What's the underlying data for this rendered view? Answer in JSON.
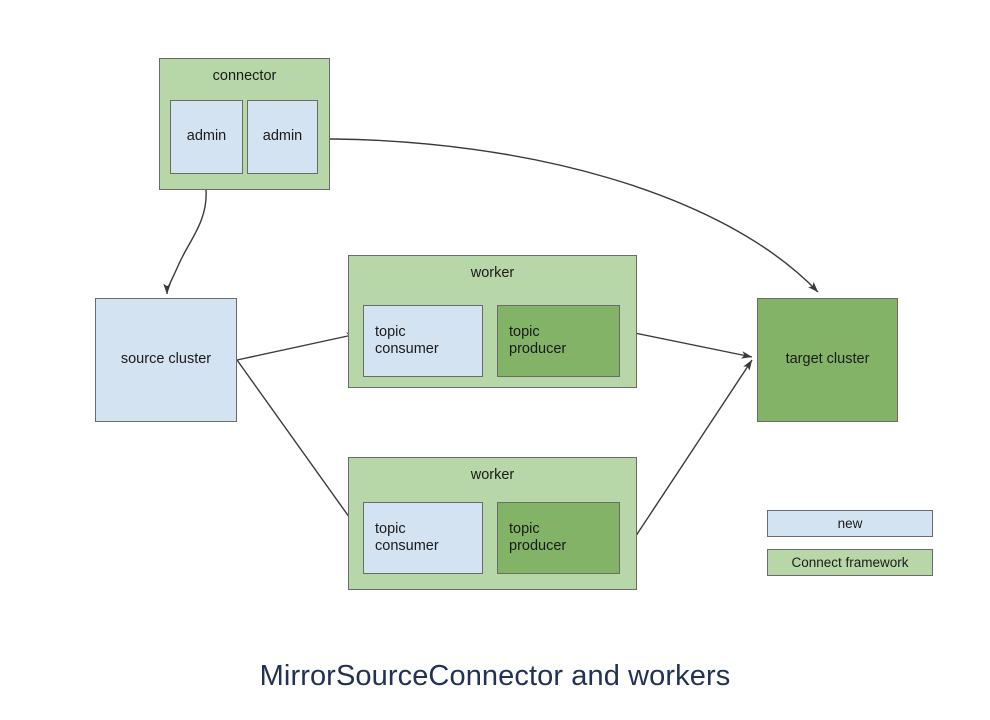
{
  "title": "MirrorSourceConnector and workers",
  "colors": {
    "new": "#d4e3f2",
    "connect_framework": "#b7d7a8",
    "connect_framework_dark": "#82b366",
    "border": "#6b6b6b",
    "edge": "#3a3a3a",
    "title_text": "#233154",
    "node_text": "#1a1a1a",
    "background": "#ffffff"
  },
  "nodes": {
    "connector": {
      "label": "connector",
      "fill": "connect_framework",
      "children": [
        {
          "label": "admin",
          "fill": "new"
        },
        {
          "label": "admin",
          "fill": "new"
        }
      ]
    },
    "source_cluster": {
      "label": "source cluster",
      "fill": "new"
    },
    "target_cluster": {
      "label": "target cluster",
      "fill": "connect_framework_dark"
    },
    "worker_1": {
      "label": "worker",
      "fill": "connect_framework",
      "consumer": {
        "line1": "topic",
        "line2": "consumer",
        "fill": "new"
      },
      "producer": {
        "line1": "topic",
        "line2": "producer",
        "fill": "connect_framework_dark"
      }
    },
    "worker_2": {
      "label": "worker",
      "fill": "connect_framework",
      "consumer": {
        "line1": "topic",
        "line2": "consumer",
        "fill": "new"
      },
      "producer": {
        "line1": "topic",
        "line2": "producer",
        "fill": "connect_framework_dark"
      }
    }
  },
  "legend": {
    "items": [
      {
        "label": "new",
        "fill": "new"
      },
      {
        "label": "Connect framework",
        "fill": "connect_framework"
      }
    ]
  },
  "edges": [
    {
      "from": "connector.admin_1",
      "to": "source_cluster",
      "style": "curved",
      "arrow": true
    },
    {
      "from": "connector.admin_2",
      "to": "target_cluster",
      "style": "curved",
      "arrow": true
    },
    {
      "from": "source_cluster",
      "to": "worker_1.consumer",
      "style": "straight",
      "arrow": true
    },
    {
      "from": "source_cluster",
      "to": "worker_2.consumer",
      "style": "straight",
      "arrow": true
    },
    {
      "from": "worker_1.consumer",
      "to": "worker_1.producer",
      "style": "straight",
      "arrow": true
    },
    {
      "from": "worker_2.consumer",
      "to": "worker_2.producer",
      "style": "straight",
      "arrow": true
    },
    {
      "from": "worker_1.producer",
      "to": "target_cluster",
      "style": "straight",
      "arrow": true
    },
    {
      "from": "worker_2.producer",
      "to": "target_cluster",
      "style": "straight",
      "arrow": true
    }
  ]
}
